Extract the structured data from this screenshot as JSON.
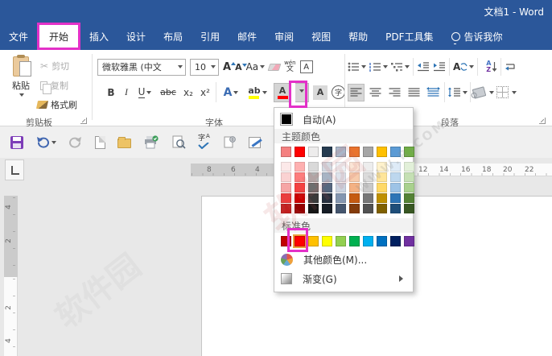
{
  "window": {
    "title": "文档1 - Word"
  },
  "tabs": [
    {
      "label": "文件"
    },
    {
      "label": "开始"
    },
    {
      "label": "插入"
    },
    {
      "label": "设计"
    },
    {
      "label": "布局"
    },
    {
      "label": "引用"
    },
    {
      "label": "邮件"
    },
    {
      "label": "审阅"
    },
    {
      "label": "视图"
    },
    {
      "label": "帮助"
    },
    {
      "label": "PDF工具集"
    },
    {
      "label": "告诉我你"
    }
  ],
  "clipboard": {
    "group_label": "剪贴板",
    "paste": "粘贴",
    "cut": "剪切",
    "copy": "复制",
    "format_painter": "格式刷"
  },
  "font_group": {
    "group_label": "字体",
    "font_name": "微软雅黑 (中文",
    "font_size": "10",
    "grow": "A",
    "shrink": "A",
    "change_case": "Aa",
    "bold": "B",
    "italic": "I",
    "underline": "U",
    "strikethrough": "abc",
    "subscript": "x₂",
    "superscript": "x²",
    "text_effects": "A",
    "highlight": "ab",
    "font_color": "A",
    "char_shading": "A",
    "enclose_char": "字",
    "pinyin_top": "wén",
    "pinyin_bottom": "文",
    "char_border": "A"
  },
  "paragraph_group": {
    "group_label": "段落",
    "sort_a": "A",
    "sort_z": "Z",
    "asian_layout": "A"
  },
  "qat": {
    "spell_zi": "字",
    "spell_a": "A"
  },
  "ruler": {
    "h_gray": [
      "8",
      "6",
      "4"
    ],
    "h_white": [
      "12",
      "14",
      "16",
      "18",
      "20",
      "22"
    ],
    "v_gray": [
      "4",
      "2"
    ],
    "v_white": [
      "2",
      "4"
    ]
  },
  "color_menu": {
    "auto": "自动(A)",
    "theme_header": "主题颜色",
    "standard_header": "标准色",
    "more_colors": "其他颜色(M)...",
    "gradient": "渐变(G)",
    "auto_swatch": "#000000",
    "theme_colors": [
      "#F48080",
      "#FE0000",
      "#EDECEC",
      "#263B50",
      "#A9B6C9",
      "#E9732E",
      "#A6A6A6",
      "#FFC000",
      "#5B9BD5",
      "#70AD47"
    ],
    "theme_variants": [
      [
        "#FCE9E9",
        "#FAD2D2",
        "#F6A5A5",
        "#EE3B3B",
        "#C21F1F"
      ],
      [
        "#FEB0B0",
        "#FD7D7D",
        "#F74040",
        "#CC0000",
        "#950000"
      ],
      [
        "#D9D9D9",
        "#AFAFAF",
        "#6E6E6E",
        "#3A3A3A",
        "#161616"
      ],
      [
        "#D3D9E1",
        "#A8B4C4",
        "#56677F",
        "#27303F",
        "#161C25"
      ],
      [
        "#EEF1F5",
        "#DDE2EB",
        "#CBD3E0",
        "#8496B0",
        "#45566E"
      ],
      [
        "#FBE5D6",
        "#F7CBAC",
        "#F4B183",
        "#C55A11",
        "#843C0C"
      ],
      [
        "#EDEDED",
        "#DBDBDB",
        "#C9C9C9",
        "#777777",
        "#525252"
      ],
      [
        "#FFF2CC",
        "#FFE599",
        "#FFD966",
        "#BF9000",
        "#7F6000"
      ],
      [
        "#DEEBF7",
        "#BDD7EE",
        "#9DC3E6",
        "#2E75B6",
        "#1F4E79"
      ],
      [
        "#E2F0D9",
        "#C5E0B4",
        "#A9D18E",
        "#548235",
        "#385723"
      ]
    ],
    "standard_colors": [
      "#C00000",
      "#FF0000",
      "#FFC000",
      "#FFFF00",
      "#92D050",
      "#00B050",
      "#00B0F0",
      "#0070C0",
      "#002060",
      "#7030A0"
    ],
    "standard_selected_index": 1
  },
  "watermark": {
    "site": "软件园",
    "url": "WWW.R.COM"
  },
  "colors": {
    "titlebar": "#2B579A",
    "annotation": "#E331C8",
    "selection_border": "#E8A33D",
    "font_color_current": "#FF0000",
    "highlight_current": "#FFFF00"
  }
}
